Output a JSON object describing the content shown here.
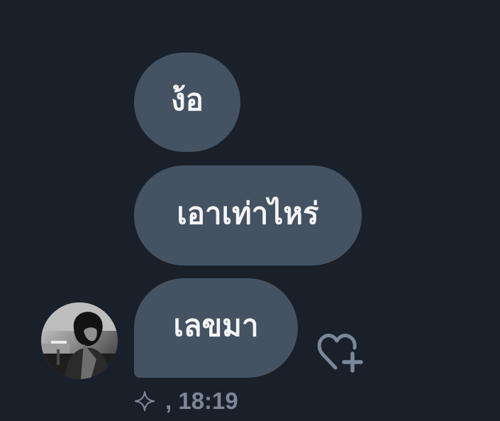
{
  "messages": [
    {
      "text": "ง้อ"
    },
    {
      "text": "เอาเท่าไหร่"
    },
    {
      "text": "เลขมา"
    }
  ],
  "meta": {
    "timestamp": ", 18:19",
    "sparkle_icon": "sparkle-icon"
  },
  "react": {
    "icon": "heart-add-icon"
  },
  "colors": {
    "background": "#19202a",
    "bubble": "#445262",
    "bubble_text": "#f3f5f7",
    "muted": "#7c8797"
  }
}
